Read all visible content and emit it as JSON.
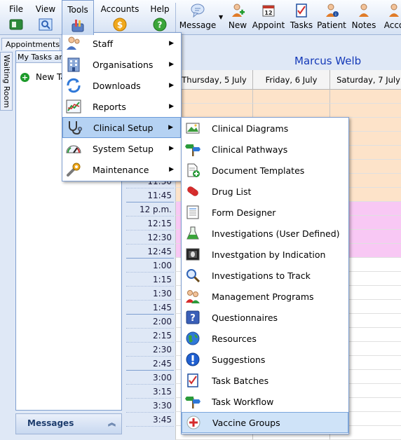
{
  "menubar": {
    "file": "File",
    "view": "View",
    "tools": "Tools",
    "accounts": "Accounts",
    "help": "Help"
  },
  "toolbar": {
    "message": "Message",
    "new": "New",
    "appoint": "Appoint",
    "appoint_day": "12",
    "tasks": "Tasks",
    "patient": "Patient",
    "notes": "Notes",
    "accounts": "Acco"
  },
  "left": {
    "appointments_tab": "Appointments",
    "waiting_room_tab": "Waiting Room",
    "tasks_header": "My Tasks an",
    "new_task": "New Ta",
    "messages": "Messages"
  },
  "calendar": {
    "user": "Marcus Welb",
    "days": [
      "Thursday, 5 July",
      "Friday, 6 July",
      "Saturday, 7 July"
    ],
    "times": [
      "",
      "",
      "",
      "",
      "",
      "",
      "11:30",
      "11:45",
      "12 p.m.",
      "12:15",
      "12:30",
      "12:45",
      "1:00",
      "1:15",
      "1:30",
      "1:45",
      "2:00",
      "2:15",
      "2:30",
      "2:45",
      "3:00",
      "3:15",
      "3:30",
      "3:45",
      ""
    ]
  },
  "tools_menu": {
    "items": [
      {
        "label": "Staff"
      },
      {
        "label": "Organisations"
      },
      {
        "label": "Downloads"
      },
      {
        "label": "Reports"
      },
      {
        "label": "Clinical Setup"
      },
      {
        "label": "System Setup"
      },
      {
        "label": "Maintenance"
      }
    ],
    "selected": "Clinical Setup"
  },
  "clinical_menu": {
    "items": [
      {
        "label": "Clinical Diagrams"
      },
      {
        "label": "Clinical Pathways"
      },
      {
        "label": "Document Templates"
      },
      {
        "label": "Drug List"
      },
      {
        "label": "Form Designer"
      },
      {
        "label": "Investigations (User Defined)"
      },
      {
        "label": "Investgation by Indication"
      },
      {
        "label": "Investigations to Track"
      },
      {
        "label": "Management Programs"
      },
      {
        "label": "Questionnaires"
      },
      {
        "label": "Resources"
      },
      {
        "label": "Suggestions"
      },
      {
        "label": "Task Batches"
      },
      {
        "label": "Task Workflow"
      },
      {
        "label": "Vaccine Groups"
      }
    ],
    "selected": "Vaccine Groups"
  },
  "colors": {
    "accent": "#1439b8",
    "morning_slot": "#fde3c9",
    "afternoon_slot": "#f8c8f4",
    "menu_highlight": "#b5d2f3"
  }
}
